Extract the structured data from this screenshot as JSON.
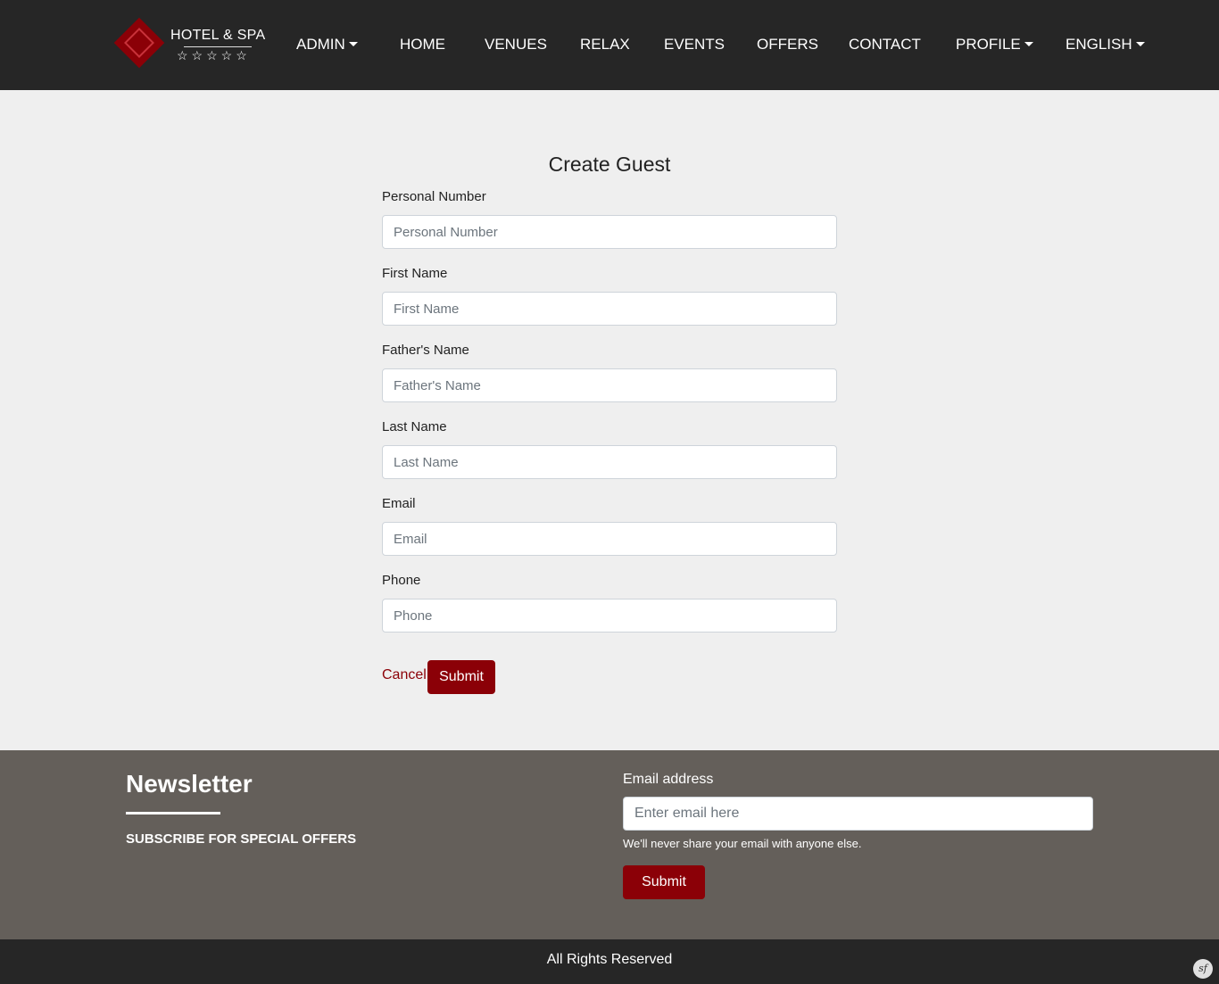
{
  "header": {
    "logo": {
      "text": "HOTEL & SPA",
      "stars": "☆☆☆☆☆"
    },
    "nav": [
      {
        "label": "ADMIN",
        "dropdown": true
      },
      {
        "label": "HOME",
        "dropdown": false
      },
      {
        "label": "VENUES",
        "dropdown": false
      },
      {
        "label": "RELAX",
        "dropdown": false
      },
      {
        "label": "EVENTS",
        "dropdown": false
      },
      {
        "label": "OFFERS",
        "dropdown": false
      },
      {
        "label": "CONTACT",
        "dropdown": false
      },
      {
        "label": "PROFILE",
        "dropdown": true
      },
      {
        "label": "ENGLISH",
        "dropdown": true
      }
    ]
  },
  "form": {
    "title": "Create Guest",
    "fields": [
      {
        "label": "Personal Number",
        "placeholder": "Personal Number",
        "value": ""
      },
      {
        "label": "First Name",
        "placeholder": "First Name",
        "value": ""
      },
      {
        "label": "Father's Name",
        "placeholder": "Father's Name",
        "value": ""
      },
      {
        "label": "Last Name",
        "placeholder": "Last Name",
        "value": ""
      },
      {
        "label": "Email",
        "placeholder": "Email",
        "value": ""
      },
      {
        "label": "Phone",
        "placeholder": "Phone",
        "value": ""
      }
    ],
    "cancel_label": "Cancel",
    "submit_label": "Submit"
  },
  "newsletter": {
    "title": "Newsletter",
    "subtitle": "SUBSCRIBE FOR SPECIAL OFFERS",
    "email_label": "Email address",
    "email_placeholder": "Enter email here",
    "help_text": "We'll never share your email with anyone else.",
    "submit_label": "Submit"
  },
  "footer": {
    "text": "All Rights Reserved",
    "debug_icon_glyph": "sf"
  },
  "colors": {
    "accent": "#8b0007",
    "navbar": "#262626",
    "newsletter_bg": "#645f5a",
    "page_bg": "#efefef"
  }
}
